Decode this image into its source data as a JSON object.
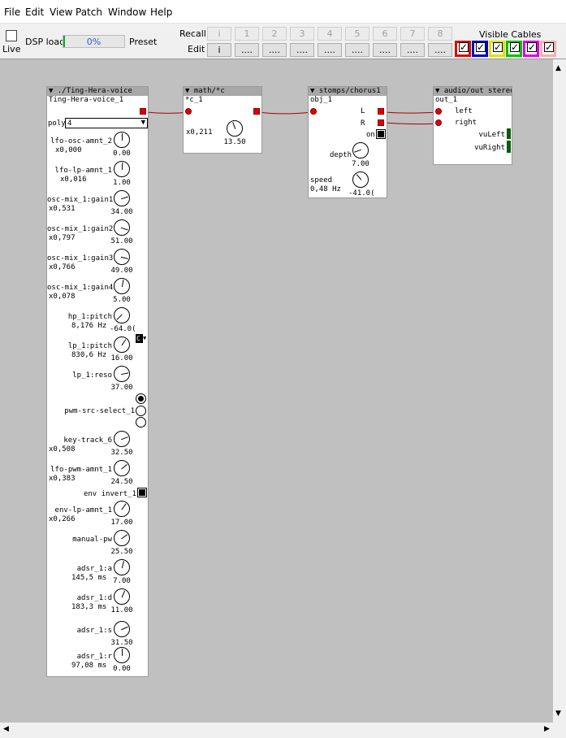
{
  "menu": [
    "File",
    "Edit",
    "View",
    "Patch",
    "Window",
    "Help"
  ],
  "toolbar": {
    "live_label": "Live",
    "dsp_label": "DSP load",
    "dsp_value": "0%",
    "preset_label": "Preset",
    "recall_label": "Recall",
    "edit_label": "Edit",
    "recall_buttons": [
      "i",
      "1",
      "2",
      "3",
      "4",
      "5",
      "6",
      "7",
      "8"
    ],
    "edit_buttons": [
      "i",
      "....",
      "....",
      "....",
      "....",
      "....",
      "....",
      "....",
      "...."
    ],
    "visible_cables_label": "Visible Cables",
    "cable_colors": [
      "#d01010",
      "#0000c0",
      "#e0e000",
      "#00c000",
      "#e000e0",
      "#f0b0b0"
    ]
  },
  "voice": {
    "title": "./Ting-Hera-voice",
    "name": "Ting-Hera-voice_1",
    "poly_label": "poly",
    "poly_value": "4",
    "params": [
      {
        "label": "lfo-osc-amnt_2",
        "sub": "x0,000",
        "value": "0.00"
      },
      {
        "label": "lfo-lp-amnt_1",
        "sub": "x0,016",
        "value": "1.00"
      },
      {
        "label": "osc-mix_1:gain1",
        "sub": "x0,531",
        "value": "34.00"
      },
      {
        "label": "osc-mix_1:gain2",
        "sub": "x0,797",
        "value": "51.00"
      },
      {
        "label": "osc-mix_1:gain3",
        "sub": "x0,766",
        "value": "49.00"
      },
      {
        "label": "osc-mix_1:gain4",
        "sub": "x0,078",
        "value": "5.00"
      },
      {
        "label": "hp_1:pitch",
        "sub": "8,176 Hz",
        "value": "-64.0("
      },
      {
        "label": "lp_1:pitch",
        "sub": "830,6 Hz",
        "value": "16.00"
      },
      {
        "label": "lp_1:reso",
        "sub": "",
        "value": "37.00"
      },
      {
        "label": "key-track_6",
        "sub": "x0,508",
        "value": "32.50"
      },
      {
        "label": "lfo-pwm-amnt_1",
        "sub": "x0,383",
        "value": "24.50"
      },
      {
        "label": "env-lp-amnt_1",
        "sub": "x0,266",
        "value": "17.00"
      },
      {
        "label": "manual-pw",
        "sub": "",
        "value": "25.50"
      },
      {
        "label": "adsr_1:a",
        "sub": "145,5 ms",
        "value": "7.00"
      },
      {
        "label": "adsr_1:d",
        "sub": "183,3 ms",
        "value": "11.00"
      },
      {
        "label": "adsr_1:s",
        "sub": "",
        "value": "31.50"
      },
      {
        "label": "adsr_1:r",
        "sub": "97,08 ms",
        "value": "0.00"
      }
    ],
    "pwm_label": "pwm-src-select_1",
    "env_invert_label": "env invert_1",
    "c_marker": "C"
  },
  "math": {
    "title": "math/*c",
    "name": "*c_1",
    "sub": "x0,211",
    "value": "13.50"
  },
  "chorus": {
    "title": "stomps/chorus1",
    "name": "obj_1",
    "out_l": "L",
    "out_r": "R",
    "on_label": "on",
    "depth_label": "depth",
    "depth_value": "7.00",
    "speed_label": "speed",
    "speed_sub": "0,48 Hz",
    "speed_value": "-41.0("
  },
  "audio": {
    "title": "audio/out stereo",
    "name": "out_1",
    "in_left": "left",
    "in_right": "right",
    "vu_left": "vuLeft",
    "vu_right": "vuRight"
  }
}
